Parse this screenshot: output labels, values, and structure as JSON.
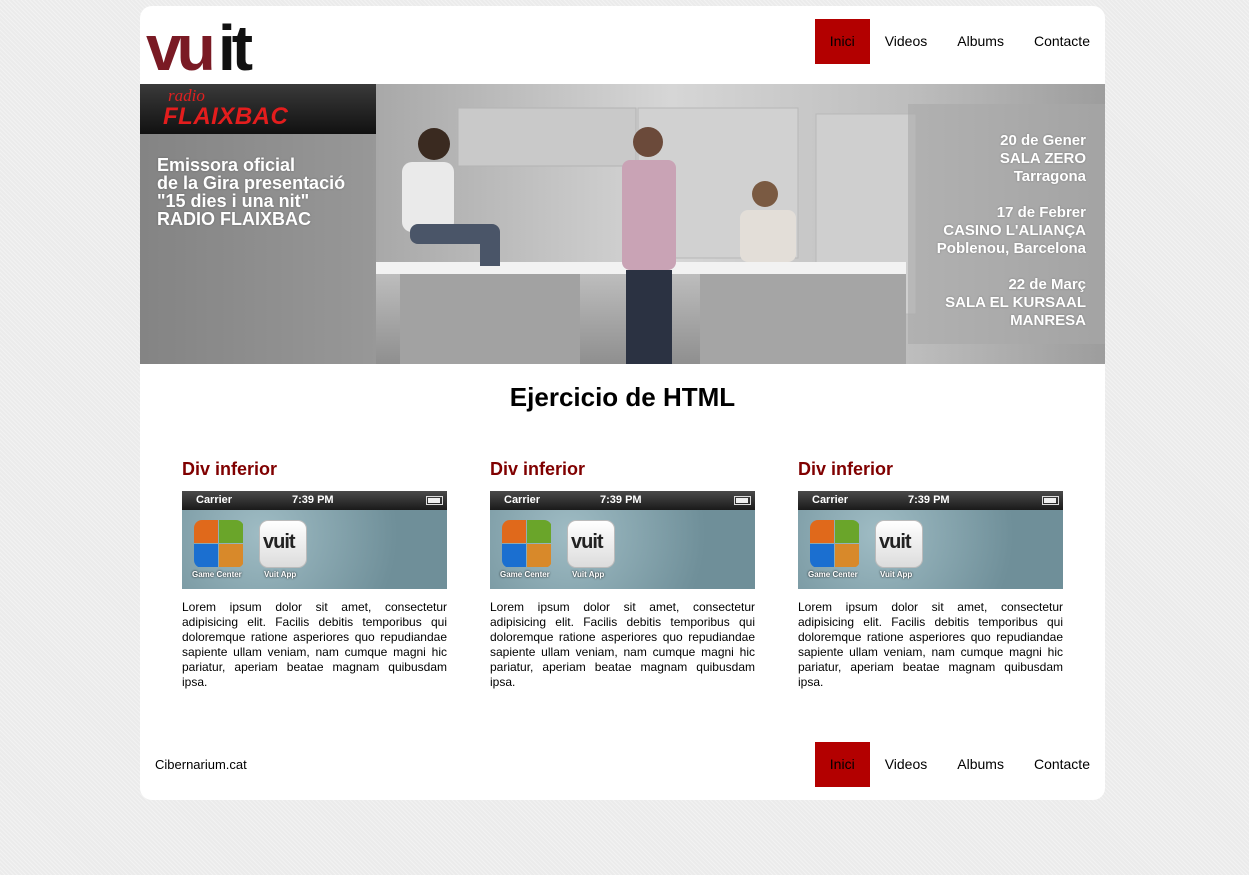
{
  "logo": {
    "text": "vuit"
  },
  "nav": [
    "Inici",
    "Videos",
    "Albums",
    "Contacte"
  ],
  "banner": {
    "radio_small": "radio",
    "radio_brand": "FLAIXBAC",
    "promo": [
      "Emissora oficial",
      "de la Gira presentació",
      "\"15 dies i una nit\"",
      "RADIO  FLAIXBAC"
    ],
    "gigs": [
      [
        "20 de Gener",
        "SALA ZERO",
        "Tarragona"
      ],
      [
        "17 de Febrer",
        "CASINO L'ALIANÇA",
        "Poblenou, Barcelona"
      ],
      [
        "22 de Març",
        "SALA EL KURSAAL",
        "MANRESA"
      ]
    ]
  },
  "title": "Ejercicio de HTML",
  "columns": [
    {
      "heading": "Div inferior",
      "phone": {
        "carrier": "Carrier",
        "time": "7:39 PM",
        "app1": "Game Center",
        "app2": "Vuit App",
        "app_logo": "vuit"
      },
      "text": "Lorem ipsum dolor sit amet, consectetur adipisicing elit. Facilis debitis temporibus qui doloremque ratione asperiores quo repudiandae sapiente ullam veniam, nam cumque magni hic pariatur, aperiam beatae magnam quibusdam ipsa."
    },
    {
      "heading": "Div inferior",
      "phone": {
        "carrier": "Carrier",
        "time": "7:39 PM",
        "app1": "Game Center",
        "app2": "Vuit App",
        "app_logo": "vuit"
      },
      "text": "Lorem ipsum dolor sit amet, consectetur adipisicing elit. Facilis debitis temporibus qui doloremque ratione asperiores quo repudiandae sapiente ullam veniam, nam cumque magni hic pariatur, aperiam beatae magnam quibusdam ipsa."
    },
    {
      "heading": "Div inferior",
      "phone": {
        "carrier": "Carrier",
        "time": "7:39 PM",
        "app1": "Game Center",
        "app2": "Vuit App",
        "app_logo": "vuit"
      },
      "text": "Lorem ipsum dolor sit amet, consectetur adipisicing elit. Facilis debitis temporibus qui doloremque ratione asperiores quo repudiandae sapiente ullam veniam, nam cumque magni hic pariatur, aperiam beatae magnam quibusdam ipsa."
    }
  ],
  "footer": {
    "copyright": "Cibernarium.cat",
    "nav": [
      "Inici",
      "Videos",
      "Albums",
      "Contacte"
    ]
  },
  "colors": {
    "accent": "#b30000",
    "heading": "#800000",
    "logo_dark": "#7a1a24",
    "logo_black": "#111111"
  }
}
